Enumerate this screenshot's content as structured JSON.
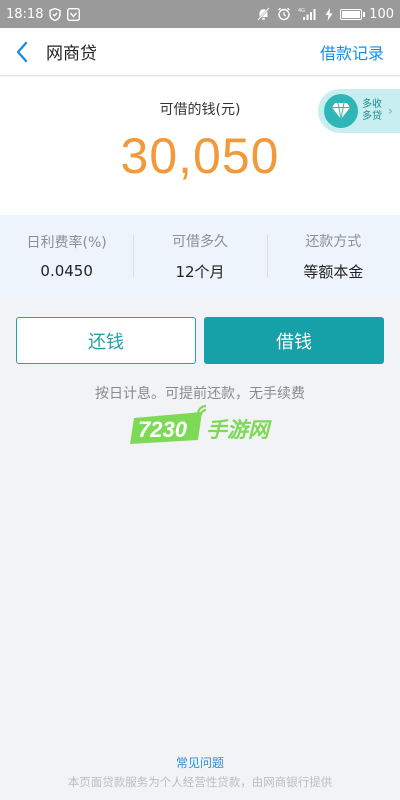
{
  "status_bar": {
    "time": "18:18",
    "network": "4G",
    "battery": "100"
  },
  "nav": {
    "title": "网商贷",
    "right_link": "借款记录"
  },
  "amount": {
    "label": "可借的钱(元)",
    "value": "30,050"
  },
  "promo": {
    "text": "多收多贷"
  },
  "info": [
    {
      "label": "日利费率(%)",
      "value": "0.0450"
    },
    {
      "label": "可借多久",
      "value": "12个月"
    },
    {
      "label": "还款方式",
      "value": "等额本金"
    }
  ],
  "actions": {
    "repay_label": "还钱",
    "borrow_label": "借钱"
  },
  "hint": "按日计息。可提前还款，无手续费",
  "watermark": {
    "number": "7230",
    "text": "手游网"
  },
  "footer": {
    "faq": "常见问题",
    "disclaimer": "本页面贷款服务为个人经营性贷款，由网商银行提供"
  },
  "colors": {
    "accent_blue": "#1a8ee6",
    "teal": "#16a0a8",
    "amount_orange": "#f09a3c"
  }
}
